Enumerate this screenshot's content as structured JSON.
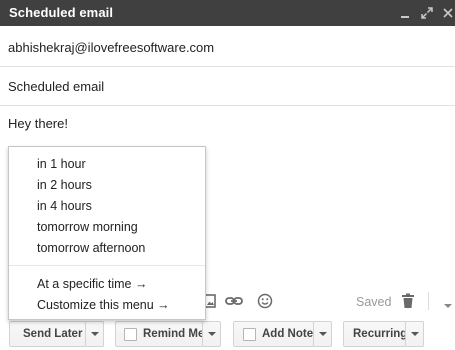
{
  "window": {
    "title": "Scheduled email",
    "controls": [
      "minimize-icon",
      "expand-icon",
      "close-icon"
    ]
  },
  "compose": {
    "to": "abhishekraj@ilovefreesoftware.com",
    "subject": "Scheduled email",
    "body": "Hey there!"
  },
  "send_later_menu": {
    "items": [
      "in 1 hour",
      "in 2 hours",
      "in 4 hours",
      "tomorrow morning",
      "tomorrow afternoon"
    ],
    "extra_items": [
      "At a specific time →",
      "Customize this menu →"
    ]
  },
  "toolbar": {
    "icons": [
      "photo-icon",
      "link-icon",
      "emoji-icon",
      "trash-icon",
      "more-options-icon"
    ],
    "saved_label": "Saved"
  },
  "buttons": {
    "send_later": "Send Later",
    "remind_me": "Remind Me",
    "add_note": "Add Note",
    "recurring": "Recurring"
  },
  "colors": {
    "titlebar": "#404040",
    "divider": "#e2e2e2"
  }
}
